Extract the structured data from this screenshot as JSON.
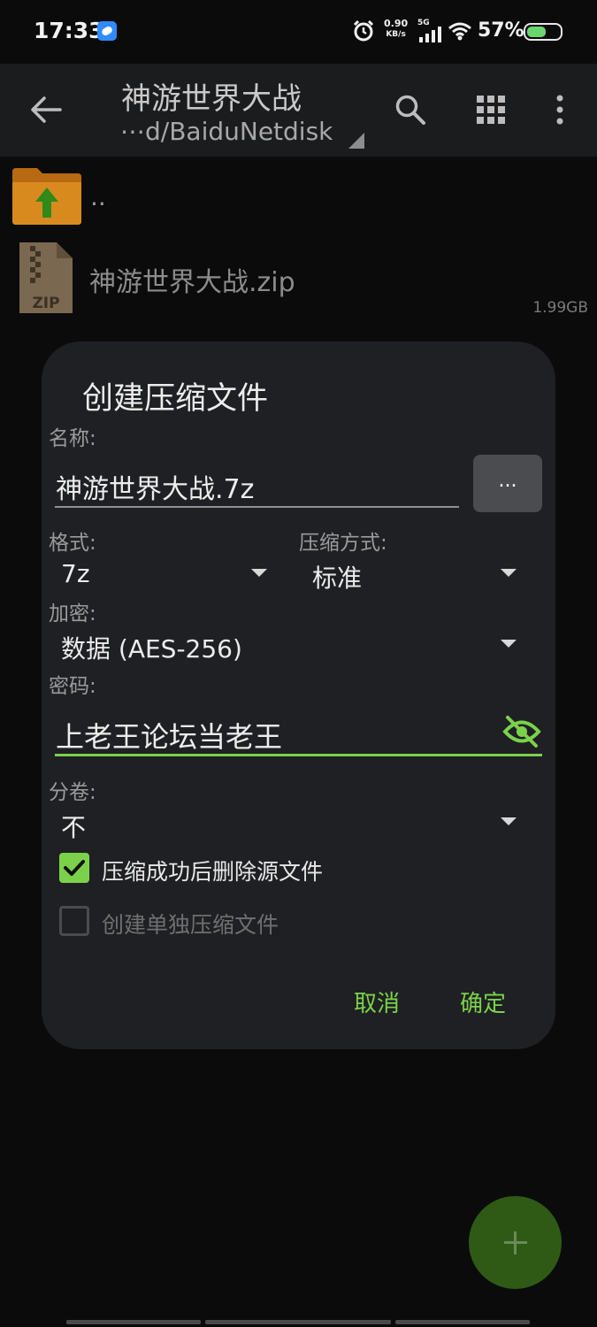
{
  "status_bar": {
    "time": "17:33",
    "net_speed_value": "0.90",
    "net_speed_unit": "KB/s",
    "network": "5G",
    "battery": "57%",
    "battery_level": 0.57
  },
  "toolbar": {
    "title": "神游世界大战",
    "path": "⋯d/BaiduNetdisk"
  },
  "files": [
    {
      "label": ".."
    },
    {
      "name": "神游世界大战.zip",
      "size": "1.99GB",
      "icon_text": "ZIP"
    }
  ],
  "dialog": {
    "title": "创建压缩文件",
    "name_label": "名称:",
    "name_value": "神游世界大战.7z",
    "browse_label": "...",
    "format_label": "格式:",
    "format_value": "7z",
    "method_label": "压缩方式:",
    "method_value": "标准",
    "encrypt_label": "加密:",
    "encrypt_value": "数据 (AES-256)",
    "password_label": "密码:",
    "password_value": "上老王论坛当老王",
    "split_label": "分卷:",
    "split_value": "不",
    "delete_source_label": "压缩成功后删除源文件",
    "delete_source_checked": true,
    "separate_label": "创建单独压缩文件",
    "separate_checked": false,
    "cancel_label": "取消",
    "ok_label": "确定"
  },
  "colors": {
    "accent": "#7bd24a",
    "dialog_bg": "#1f2023",
    "toolbar_bg": "#1b1c1e",
    "fab": "#2e5a16"
  }
}
